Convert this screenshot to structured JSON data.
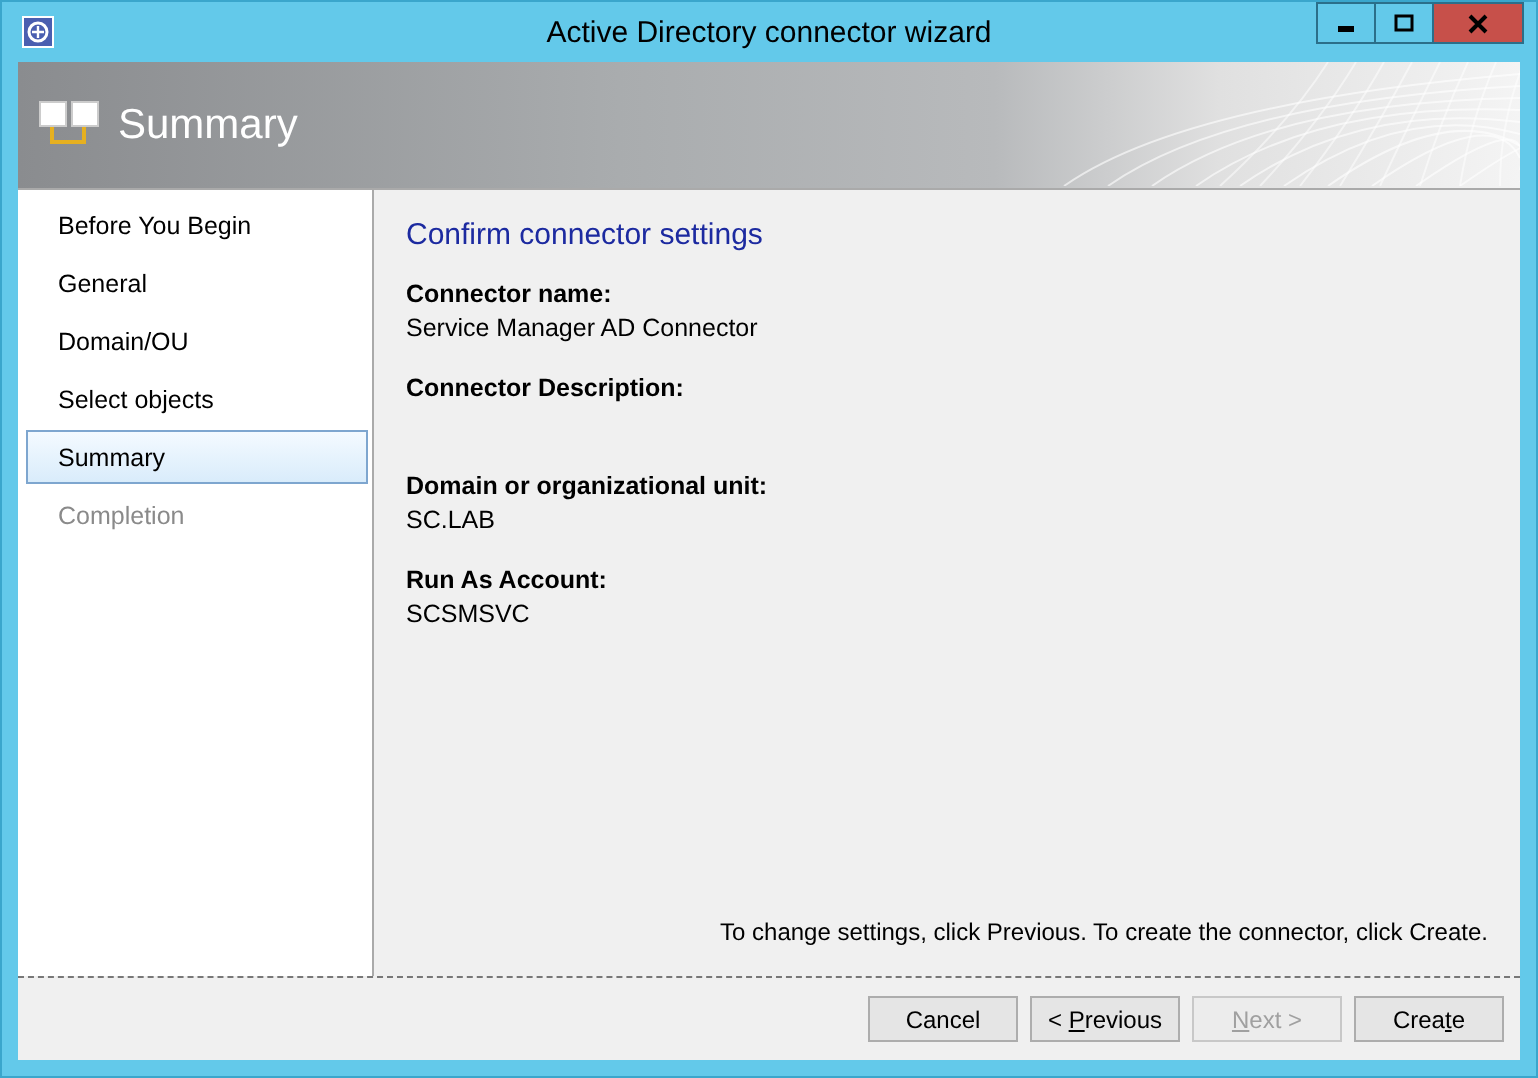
{
  "window": {
    "title": "Active Directory connector wizard"
  },
  "header": {
    "title": "Summary"
  },
  "sidebar": {
    "items": [
      {
        "label": "Before You Begin",
        "selected": false,
        "disabled": false
      },
      {
        "label": "General",
        "selected": false,
        "disabled": false
      },
      {
        "label": "Domain/OU",
        "selected": false,
        "disabled": false
      },
      {
        "label": "Select objects",
        "selected": false,
        "disabled": false
      },
      {
        "label": "Summary",
        "selected": true,
        "disabled": false
      },
      {
        "label": "Completion",
        "selected": false,
        "disabled": true
      }
    ]
  },
  "content": {
    "heading": "Confirm connector settings",
    "fields": [
      {
        "label": "Connector name:",
        "value": "Service Manager AD Connector"
      },
      {
        "label": "Connector Description:"
      },
      {
        "label": "Domain or organizational unit:",
        "value": "SC.LAB"
      },
      {
        "label": "Run As Account:",
        "value": "SCSMSVC"
      }
    ],
    "note": "To change settings, click Previous. To create the connector, click Create."
  },
  "buttons": [
    {
      "before": "Cancel",
      "disabled": false
    },
    {
      "before": "< ",
      "key": "P",
      "after": "revious",
      "disabled": false
    },
    {
      "key": "N",
      "after": "ext >",
      "disabled": true
    },
    {
      "before": "Crea",
      "key": "t",
      "after": "e",
      "disabled": false
    }
  ]
}
